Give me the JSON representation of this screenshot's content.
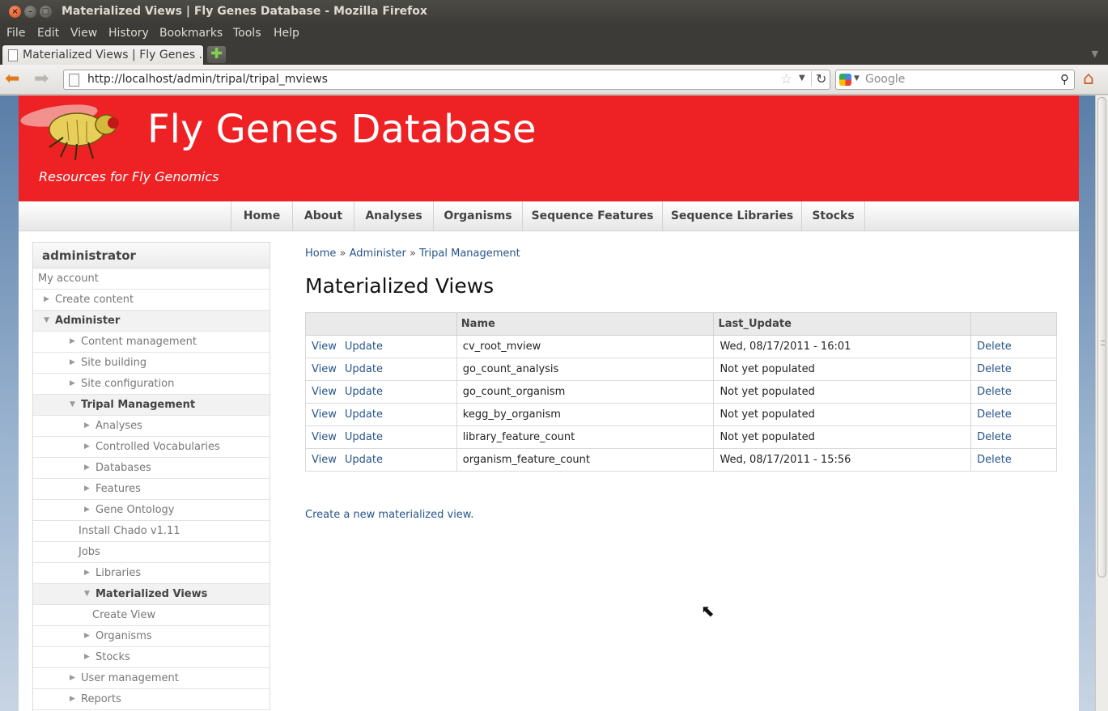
{
  "window": {
    "title": "Materialized Views | Fly Genes Database - Mozilla Firefox"
  },
  "menu": [
    "File",
    "Edit",
    "View",
    "History",
    "Bookmarks",
    "Tools",
    "Help"
  ],
  "tab": {
    "label": "Materialized Views | Fly Genes ...",
    "newtab_symbol": "✚"
  },
  "nav": {
    "url": "http://localhost/admin/tripal/tripal_mviews",
    "search_placeholder": "Google",
    "icons": [
      "back-icon",
      "forward-icon",
      "page-icon",
      "star-icon",
      "reload-icon",
      "search-icon",
      "home-icon"
    ]
  },
  "site": {
    "name": "Fly Genes Database",
    "slogan": "Resources for Fly Genomics",
    "header_color": "#ee2124"
  },
  "primary_nav": [
    "Home",
    "About",
    "Analyses",
    "Organisms",
    "Sequence Features",
    "Sequence Libraries",
    "Stocks"
  ],
  "sidebar": {
    "title": "administrator",
    "items": [
      {
        "label": "My account",
        "arrow": ""
      },
      {
        "label": "Create content",
        "arrow": "▶"
      },
      {
        "label": "Administer",
        "arrow": "▼",
        "bold": true
      },
      {
        "label": "Content management",
        "arrow": "▶"
      },
      {
        "label": "Site building",
        "arrow": "▶"
      },
      {
        "label": "Site configuration",
        "arrow": "▶"
      },
      {
        "label": "Tripal Management",
        "arrow": "▼",
        "bold": true
      },
      {
        "label": "Analyses",
        "arrow": "▶"
      },
      {
        "label": "Controlled Vocabularies",
        "arrow": "▶"
      },
      {
        "label": "Databases",
        "arrow": "▶"
      },
      {
        "label": "Features",
        "arrow": "▶"
      },
      {
        "label": "Gene Ontology",
        "arrow": "▶"
      },
      {
        "label": "Install Chado v1.11",
        "arrow": ""
      },
      {
        "label": "Jobs",
        "arrow": ""
      },
      {
        "label": "Libraries",
        "arrow": "▶"
      },
      {
        "label": "Materialized Views",
        "arrow": "▼",
        "bold": true
      },
      {
        "label": "Create View",
        "arrow": ""
      },
      {
        "label": "Organisms",
        "arrow": "▶"
      },
      {
        "label": "Stocks",
        "arrow": "▶"
      },
      {
        "label": "User management",
        "arrow": "▶"
      },
      {
        "label": "Reports",
        "arrow": "▶"
      }
    ]
  },
  "breadcrumb": [
    "Home",
    "Administer",
    "Tripal Management"
  ],
  "breadcrumb_sep": "»",
  "page_title": "Materialized Views",
  "table": {
    "headers": [
      "",
      "Name",
      "Last_Update",
      ""
    ],
    "view_label": "View",
    "update_label": "Update",
    "delete_label": "Delete",
    "rows": [
      {
        "name": "cv_root_mview",
        "last_update": "Wed, 08/17/2011 - 16:01"
      },
      {
        "name": "go_count_analysis",
        "last_update": "Not yet populated"
      },
      {
        "name": "go_count_organism",
        "last_update": "Not yet populated"
      },
      {
        "name": "kegg_by_organism",
        "last_update": "Not yet populated"
      },
      {
        "name": "library_feature_count",
        "last_update": "Not yet populated"
      },
      {
        "name": "organism_feature_count",
        "last_update": "Wed, 08/17/2011 - 15:56"
      }
    ]
  },
  "create_link": "Create a new materialized view."
}
